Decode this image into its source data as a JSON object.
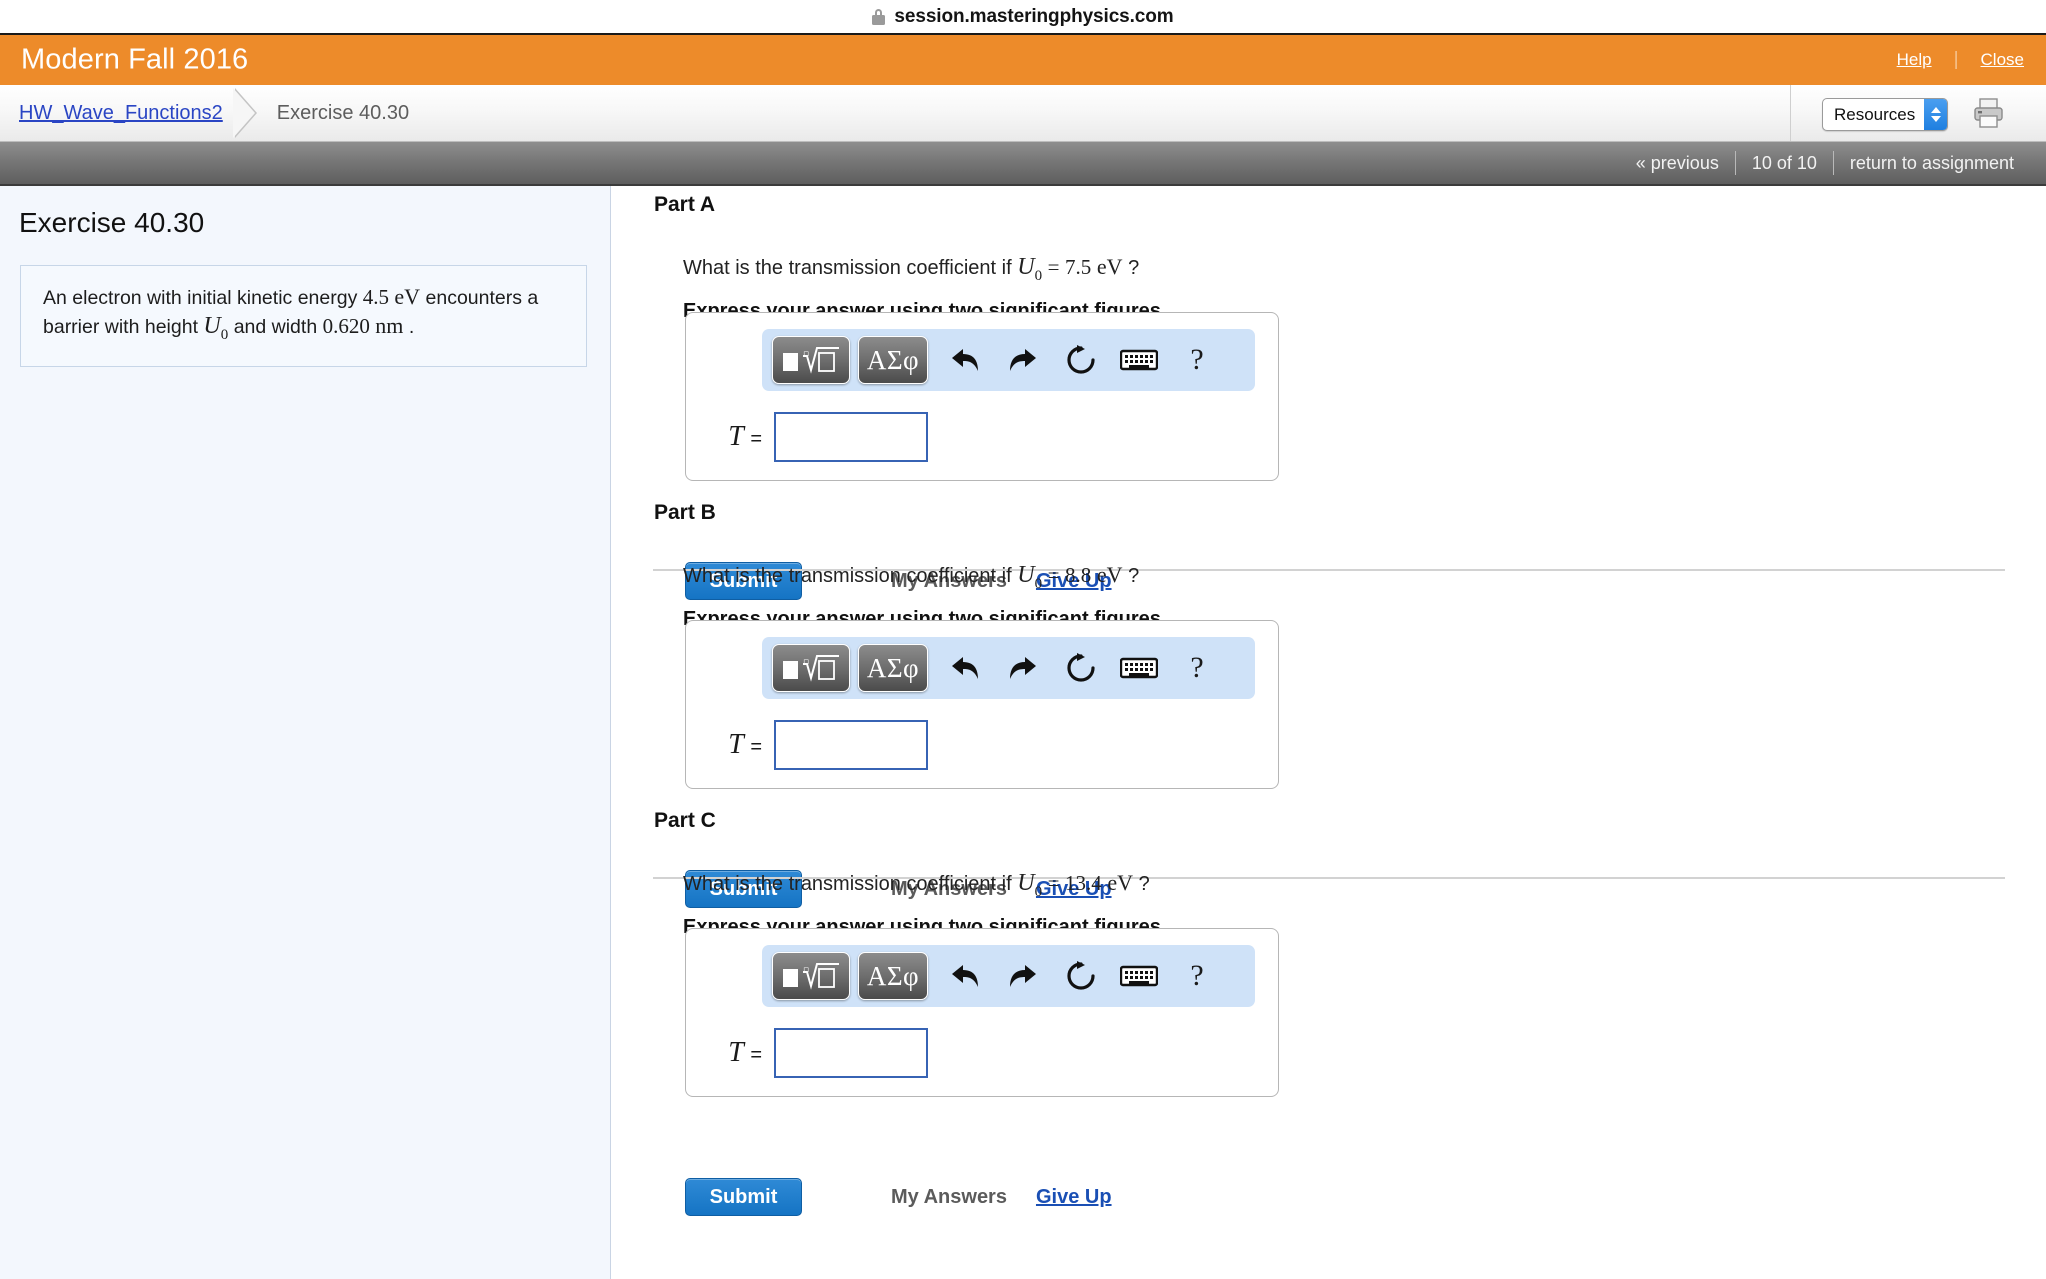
{
  "browser": {
    "url": "session.masteringphysics.com",
    "lock_icon": "lock-icon"
  },
  "banner": {
    "title": "Modern Fall 2016",
    "help_label": "Help",
    "separator": "|",
    "close_label": "Close"
  },
  "breadcrumb": {
    "assignment_link": "HW_Wave_Functions2",
    "current": "Exercise 40.30",
    "resources_label": "Resources",
    "print_icon": "printer-icon"
  },
  "navbar": {
    "previous_label": "« previous",
    "page_indicator": "10 of 10",
    "return_label": "return to assignment",
    "separator": "|"
  },
  "sidebar": {
    "title": "Exercise 40.30",
    "problem": {
      "line1_a": "An electron with initial kinetic energy",
      "line1_num": "4.5",
      "line1_unit": "eV",
      "line1_b": "encounters",
      "line2_a": "a barrier with height",
      "line2_var": "U",
      "line2_sub": "0",
      "line2_b": "and width",
      "line2_num": "0.620",
      "line2_unit": "nm",
      "line2_end": "."
    }
  },
  "toolbar": {
    "sqrt_button": "template-sqrt-icon",
    "greek_button": "ΑΣφ",
    "undo_icon": "undo-icon",
    "redo_icon": "redo-icon",
    "reset_icon": "reset-icon",
    "keyboard_icon": "keyboard-icon",
    "help_icon": "?"
  },
  "answer": {
    "label_var": "T",
    "label_eq": "=",
    "input_value": "",
    "input_placeholder": ""
  },
  "actions": {
    "submit_label": "Submit",
    "my_answers_label": "My Answers",
    "give_up_label": "Give Up"
  },
  "parts": [
    {
      "id": "A",
      "title": "Part A",
      "question_prefix": "What is the transmission coefficient if",
      "question_var": "U",
      "question_sub": "0",
      "question_eq": "=",
      "question_value": "7.5",
      "question_unit": "eV",
      "question_suffix": "?",
      "instruction": "Express your answer using two significant figures."
    },
    {
      "id": "B",
      "title": "Part B",
      "question_prefix": "What is the transmission coefficient if",
      "question_var": "U",
      "question_sub": "0",
      "question_eq": "=",
      "question_value": "8.8",
      "question_unit": "eV",
      "question_suffix": "?",
      "instruction": "Express your answer using two significant figures."
    },
    {
      "id": "C",
      "title": "Part C",
      "question_prefix": "What is the transmission coefficient if",
      "question_var": "U",
      "question_sub": "0",
      "question_eq": "=",
      "question_value": "13.4",
      "question_unit": "eV",
      "question_suffix": "?",
      "instruction": "Express your answer using two significant figures."
    }
  ],
  "colors": {
    "banner_orange": "#ed8b2a",
    "submit_blue": "#1574c4",
    "link_blue": "#2a45c4",
    "sidebar_bg": "#f3f7fd",
    "toolbar_blue": "#cfe2f8",
    "navbar_gray": "#777777"
  }
}
